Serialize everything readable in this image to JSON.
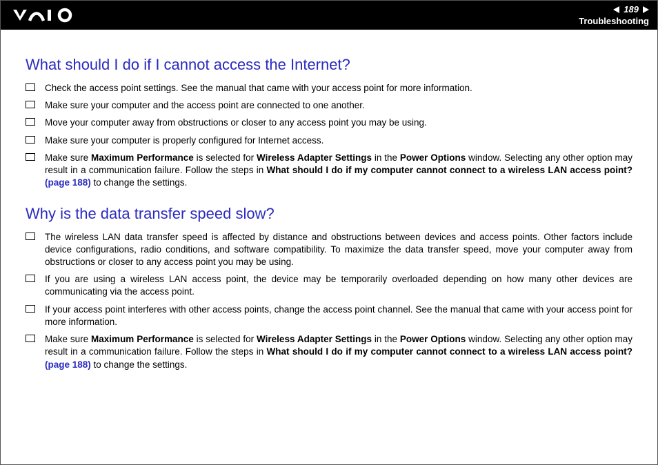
{
  "header": {
    "page_number": "189",
    "section": "Troubleshooting"
  },
  "sections": [
    {
      "heading": "What should I do if I cannot access the Internet?",
      "items": [
        {
          "plain": "Check the access point settings. See the manual that came with your access point for more information."
        },
        {
          "plain": "Make sure your computer and the access point are connected to one another."
        },
        {
          "plain": "Move your computer away from obstructions or closer to any access point you may be using."
        },
        {
          "plain": "Make sure your computer is properly configured for Internet access."
        },
        {
          "t1": "Make sure ",
          "b1": "Maximum Performance",
          "t2": " is selected for ",
          "b2": "Wireless Adapter Settings",
          "t3": " in the ",
          "b3": "Power Options",
          "t4": " window. Selecting any other option may result in a communication failure. Follow the steps in ",
          "b4": "What should I do if my computer cannot connect to a wireless LAN access point?",
          "link": " (page 188)",
          "t5": " to change the settings."
        }
      ]
    },
    {
      "heading": "Why is the data transfer speed slow?",
      "items": [
        {
          "plain": "The wireless LAN data transfer speed is affected by distance and obstructions between devices and access points. Other factors include device configurations, radio conditions, and software compatibility. To maximize the data transfer speed, move your computer away from obstructions or closer to any access point you may be using."
        },
        {
          "plain": "If you are using a wireless LAN access point, the device may be temporarily overloaded depending on how many other devices are communicating via the access point."
        },
        {
          "plain": "If your access point interferes with other access points, change the access point channel. See the manual that came with your access point for more information."
        },
        {
          "t1": "Make sure ",
          "b1": "Maximum Performance",
          "t2": " is selected for ",
          "b2": "Wireless Adapter Settings",
          "t3": " in the ",
          "b3": "Power Options",
          "t4": " window. Selecting any other option may result in a communication failure. Follow the steps in ",
          "b4": "What should I do if my computer cannot connect to a wireless LAN access point?",
          "link": " (page 188)",
          "t5": " to change the settings."
        }
      ]
    }
  ]
}
